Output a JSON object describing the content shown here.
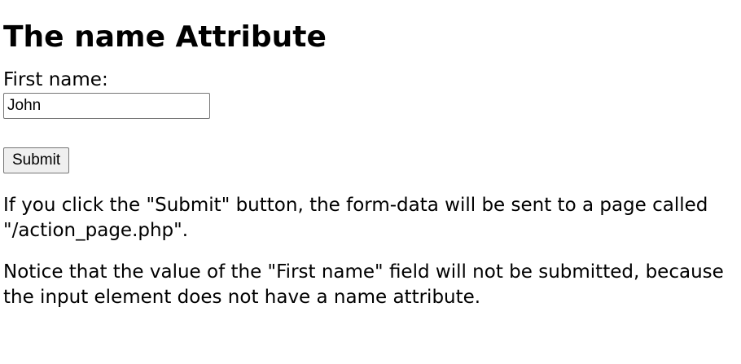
{
  "page": {
    "heading": "The name Attribute",
    "form": {
      "first_name_label": "First name:",
      "first_name_value": "John",
      "submit_label": "Submit"
    },
    "paragraphs": [
      "If you click the \"Submit\" button, the form-data will be sent to a page called \"/action_page.php\".",
      "Notice that the value of the \"First name\" field will not be submitted, because the input element does not have a name attribute."
    ]
  }
}
